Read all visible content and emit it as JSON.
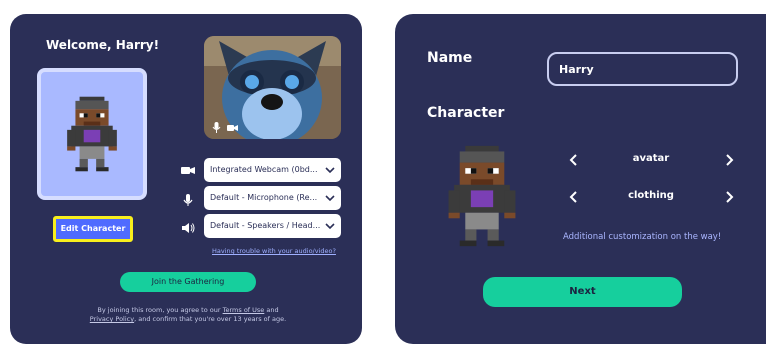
{
  "left": {
    "welcome": "Welcome, Harry!",
    "edit_character": "Edit Character",
    "devices": {
      "webcam": "Integrated Webcam (0bd...",
      "microphone": "Default - Microphone (Re...",
      "speakers": "Default - Speakers / Head..."
    },
    "trouble_link": "Having trouble with your audio/video?",
    "join_button": "Join the Gathering",
    "legal": {
      "p1": "By joining this room, you agree to our ",
      "terms": "Terms of Use",
      "p2": " and",
      "privacy": "Privacy Policy",
      "p3": ", and confirm that you're over 13 years of age."
    }
  },
  "right": {
    "name_label": "Name",
    "name_value": "Harry",
    "character_label": "Character",
    "options": [
      "avatar",
      "clothing"
    ],
    "note": "Additional customization on the way!",
    "next_button": "Next"
  },
  "colors": {
    "panel": "#2b2f57",
    "accent_green": "#16cf9d",
    "edit_button": "#4f6bff",
    "highlight": "#f8ef1c"
  }
}
